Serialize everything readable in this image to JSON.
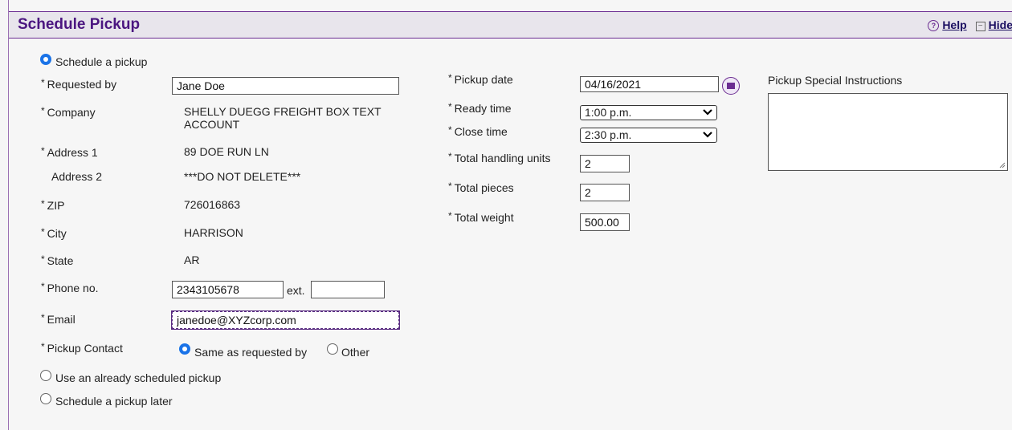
{
  "header": {
    "title": "Schedule Pickup",
    "help": "Help",
    "hide": "Hide"
  },
  "options": {
    "schedule_pickup": "Schedule a pickup",
    "use_scheduled": "Use an already scheduled pickup",
    "schedule_later": "Schedule a pickup later"
  },
  "left_form": {
    "requested_by": {
      "label": "Requested by",
      "value": "Jane Doe"
    },
    "company": {
      "label": "Company",
      "value_line1": "SHELLY DUEGG FREIGHT BOX TEXT",
      "value_line2": "ACCOUNT"
    },
    "address1": {
      "label": "Address 1",
      "value": "89 DOE RUN LN"
    },
    "address2": {
      "label": "Address 2",
      "value": "***DO NOT DELETE***"
    },
    "zip": {
      "label": "ZIP",
      "value": "726016863"
    },
    "city": {
      "label": "City",
      "value": "HARRISON"
    },
    "state": {
      "label": "State",
      "value": "AR"
    },
    "phone": {
      "label": "Phone no.",
      "value": "2343105678",
      "ext_label": "ext.",
      "ext_value": ""
    },
    "email": {
      "label": "Email",
      "value": "janedoe@XYZcorp.com"
    },
    "pickup_contact": {
      "label": "Pickup Contact",
      "same_label": "Same as requested by",
      "other_label": "Other"
    }
  },
  "middle_form": {
    "pickup_date": {
      "label": "Pickup date",
      "value": "04/16/2021"
    },
    "ready_time": {
      "label": "Ready time",
      "value": "1:00 p.m."
    },
    "close_time": {
      "label": "Close time",
      "value": "2:30 p.m."
    },
    "handling_units": {
      "label": "Total handling units",
      "value": "2"
    },
    "pieces": {
      "label": "Total pieces",
      "value": "2"
    },
    "weight": {
      "label": "Total weight",
      "value": "500.00"
    }
  },
  "instructions": {
    "label": "Pickup Special Instructions",
    "value": ""
  },
  "required_marker": "*",
  "colors": {
    "accent": "#4b1680",
    "radio_selected": "#1a73e8"
  }
}
